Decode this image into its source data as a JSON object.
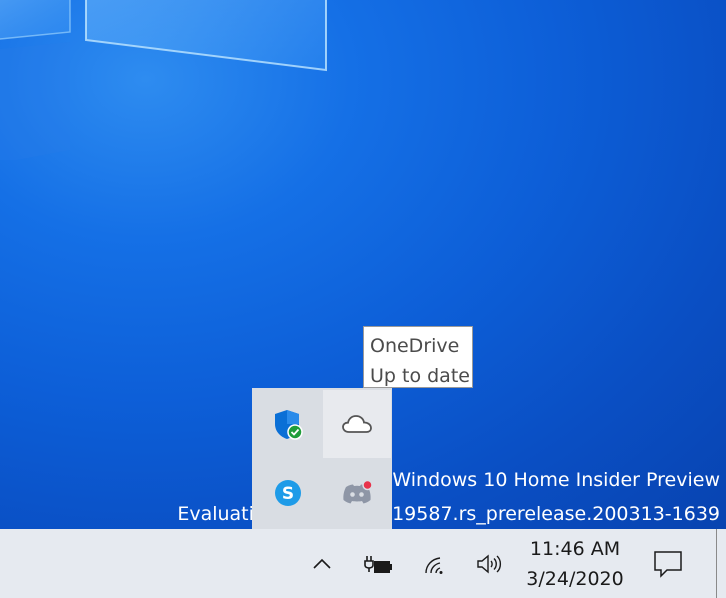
{
  "watermark": {
    "line1": "Windows 10 Home Insider Preview",
    "line2": "Evaluation copy. Build 19587.rs_prerelease.200313-1639"
  },
  "tooltip": {
    "title": "OneDrive",
    "status": "Up to date"
  },
  "tray_flyout": {
    "icons": [
      "windows-security-icon",
      "onedrive-cloud-icon",
      "skype-icon",
      "discord-icon"
    ]
  },
  "taskbar": {
    "clock_time": "11:46 AM",
    "clock_date": "3/24/2020"
  },
  "colors": {
    "desktop_blue": "#0d5fd8",
    "taskbar": "#e6eaf0",
    "flyout": "#d9dde3",
    "security_blue": "#0a6fd6",
    "security_green": "#1f9d3a",
    "skype_blue": "#1e9be8",
    "discord_badge": "#e8324a"
  }
}
